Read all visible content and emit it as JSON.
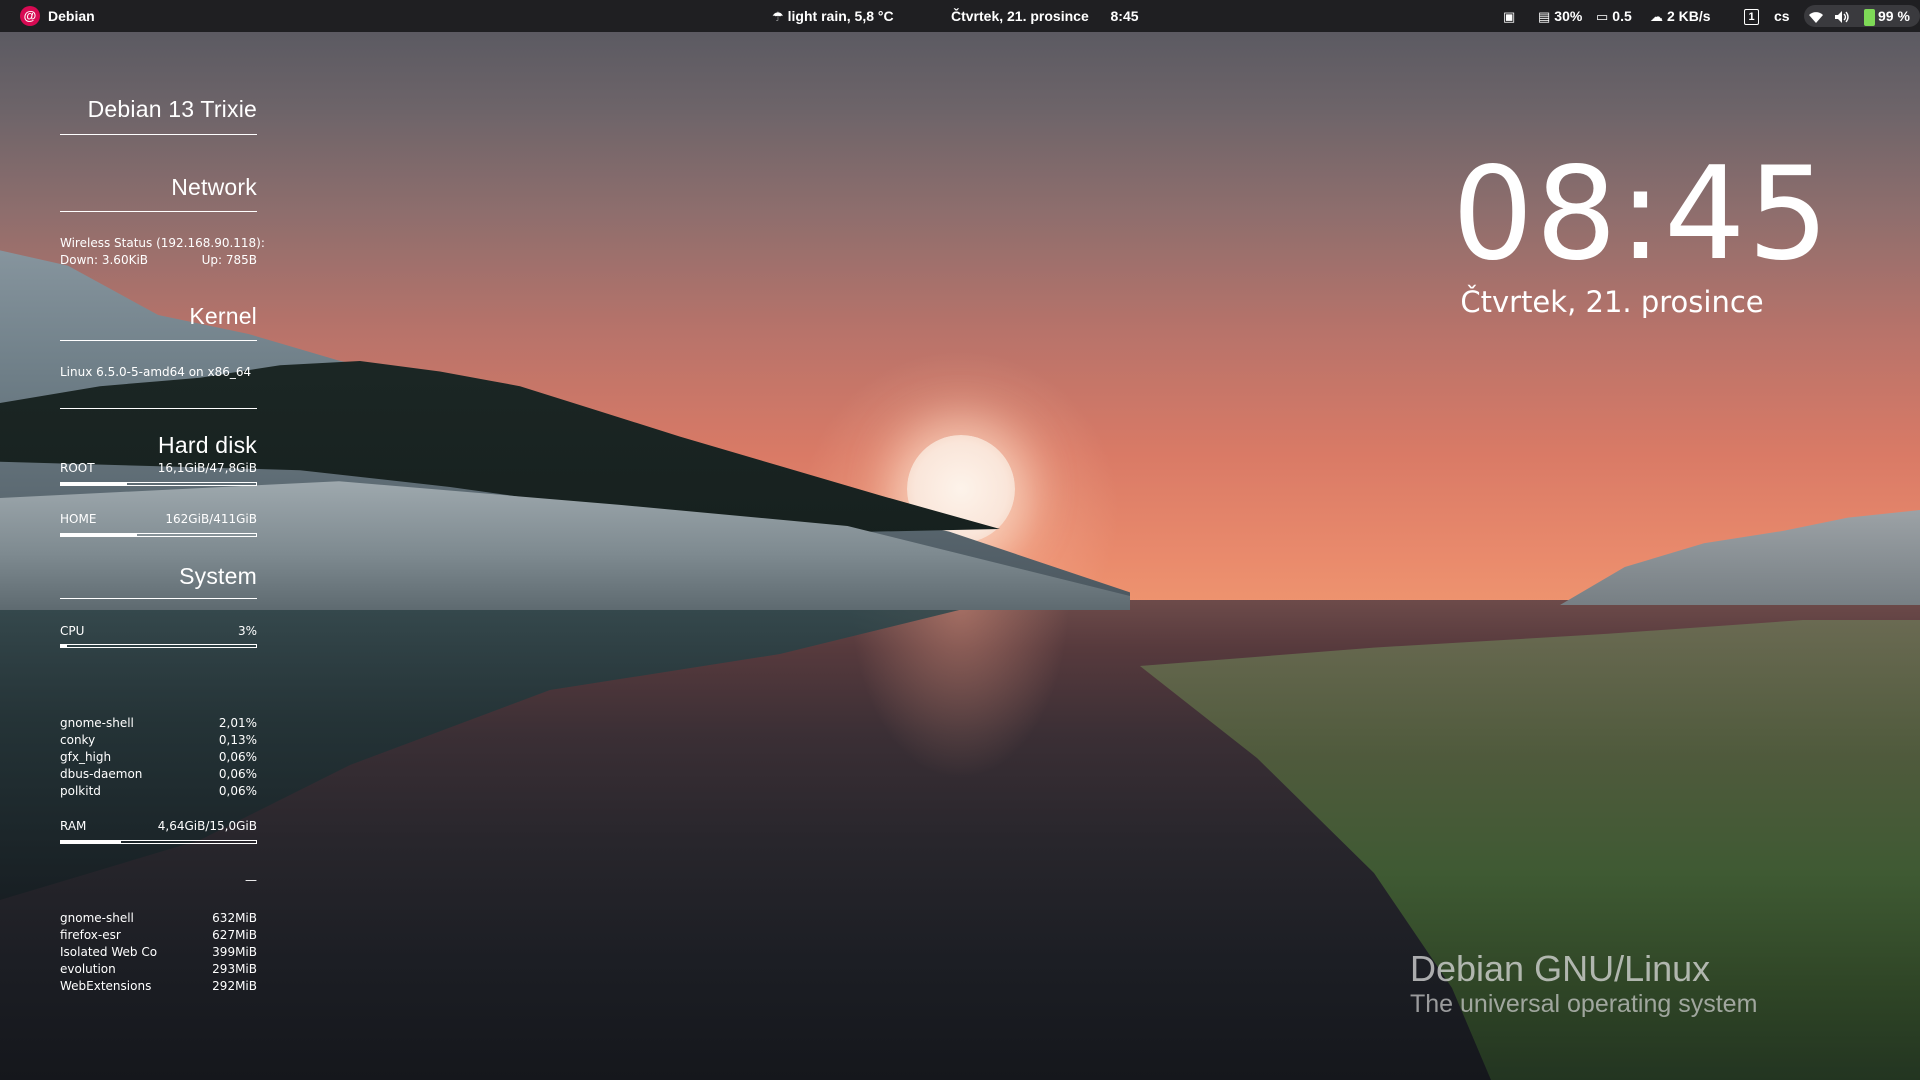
{
  "topbar": {
    "activities_label": "Debian",
    "weather": "light rain, 5,8 °C",
    "date": "Čtvrtek, 21. prosince",
    "time": "8:45",
    "cpu_load": "30%",
    "load_avg": "0.5",
    "net_speed": "2 KB/s",
    "workspace": "1",
    "keyboard_layout": "cs",
    "battery": "99 %"
  },
  "conky": {
    "distro_title": "Debian 13 Trixie",
    "network": {
      "title": "Network",
      "status": "Wireless Status (192.168.90.118):",
      "down": "Down: 3.60KiB",
      "up": "Up: 785B"
    },
    "kernel": {
      "title": "Kernel",
      "info": "Linux 6.5.0-5-amd64 on x86_64"
    },
    "disk": {
      "title": "Hard disk",
      "root_label": "ROOT",
      "root_usage": "16,1GiB/47,8GiB",
      "root_fraction": 0.34,
      "home_label": "HOME",
      "home_usage": "162GiB/411GiB",
      "home_fraction": 0.39
    },
    "system": {
      "title": "System",
      "cpu_label": "CPU",
      "cpu_value": "3%",
      "cpu_fraction": 0.03,
      "cpu_procs": [
        {
          "name": "gnome-shell",
          "value": "2,01%"
        },
        {
          "name": "conky",
          "value": "0,13%"
        },
        {
          "name": "gfx_high",
          "value": "0,06%"
        },
        {
          "name": "dbus-daemon",
          "value": "0,06%"
        },
        {
          "name": "polkitd",
          "value": "0,06%"
        }
      ],
      "ram_label": "RAM",
      "ram_value": "4,64GiB/15,0GiB",
      "ram_fraction": 0.31,
      "ram_separator": "—",
      "mem_procs": [
        {
          "name": "gnome-shell",
          "value": "632MiB"
        },
        {
          "name": "firefox-esr",
          "value": "627MiB"
        },
        {
          "name": "Isolated Web Co",
          "value": "399MiB"
        },
        {
          "name": "evolution",
          "value": "293MiB"
        },
        {
          "name": "WebExtensions",
          "value": "292MiB"
        }
      ]
    }
  },
  "clock": {
    "time": "08:45",
    "date": "Čtvrtek, 21. prosince"
  },
  "branding": {
    "name": "Debian GNU/Linux",
    "slogan": "The universal operating system"
  },
  "colors": {
    "debian_accent": "#d70a53",
    "topbar_bg": "#1f1f22",
    "battery_green": "#7ed957"
  }
}
